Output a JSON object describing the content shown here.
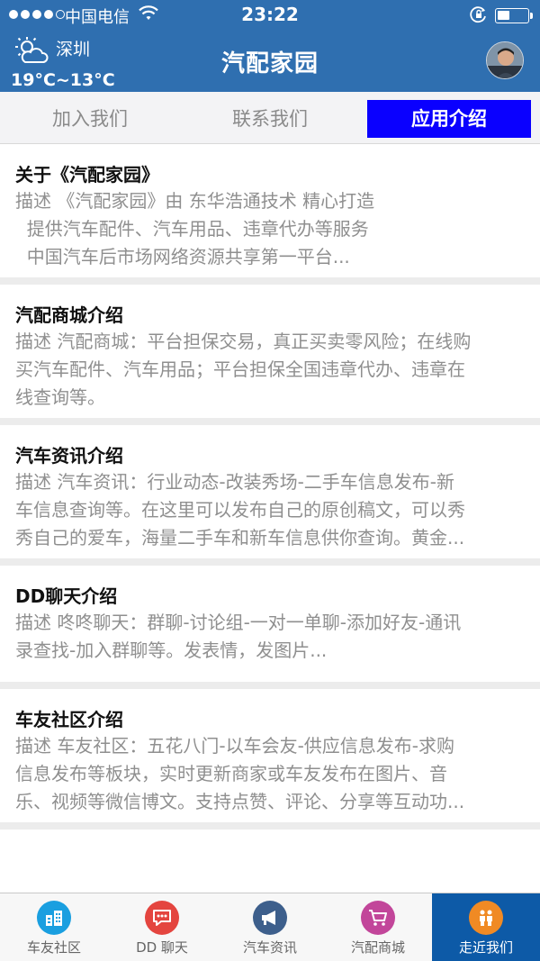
{
  "status_bar": {
    "carrier": "中国电信",
    "time": "23:22"
  },
  "header": {
    "city": "深圳",
    "temperature": "19°C~13°C",
    "title": "汽配家园"
  },
  "tabs": [
    {
      "label": "加入我们",
      "active": false
    },
    {
      "label": "联系我们",
      "active": false
    },
    {
      "label": "应用介绍",
      "active": true
    }
  ],
  "items": [
    {
      "title": "关于《汽配家园》",
      "desc": "描述 《汽配家园》由 东华浩通技术 精心打造\n  提供汽车配件、汽车用品、违章代办等服务\n  中国汽车后市场网络资源共享第一平台..."
    },
    {
      "title": "汽配商城介绍",
      "desc": "描述 汽配商城：平台担保交易，真正买卖零风险；在线购\n买汽车配件、汽车用品；平台担保全国违章代办、违章在\n线查询等。"
    },
    {
      "title": "汽车资讯介绍",
      "desc": "描述 汽车资讯：行业动态-改装秀场-二手车信息发布-新\n车信息查询等。在这里可以发布自己的原创稿文，可以秀\n秀自己的爱车，海量二手车和新车信息供你查询。黄金..."
    },
    {
      "title": "DD聊天介绍",
      "desc": "描述 咚咚聊天：群聊-讨论组-一对一单聊-添加好友-通讯\n录查找-加入群聊等。发表情，发图片..."
    },
    {
      "title": "车友社区介绍",
      "desc": "描述 车友社区：五花八门-以车会友-供应信息发布-求购\n信息发布等板块，实时更新商家或车友发布在图片、音\n乐、视频等微信博文。支持点赞、评论、分享等互动功..."
    }
  ],
  "bottom_nav": [
    {
      "label": "车友社区",
      "icon": "buildings-icon",
      "color": "#1a9fe0",
      "active": false
    },
    {
      "label": "DD 聊天",
      "icon": "chat-icon",
      "color": "#e4453f",
      "active": false
    },
    {
      "label": "汽车资讯",
      "icon": "megaphone-icon",
      "color": "#3d5f8c",
      "active": false
    },
    {
      "label": "汽配商城",
      "icon": "cart-icon",
      "color": "#c2469a",
      "active": false
    },
    {
      "label": "走近我们",
      "icon": "people-icon",
      "color": "#f08a24",
      "active": true
    }
  ],
  "colors": {
    "header_bg": "#2f6fb0",
    "active_tab_bg": "#0a00ff",
    "active_nav_bg": "#0d5aa7"
  }
}
